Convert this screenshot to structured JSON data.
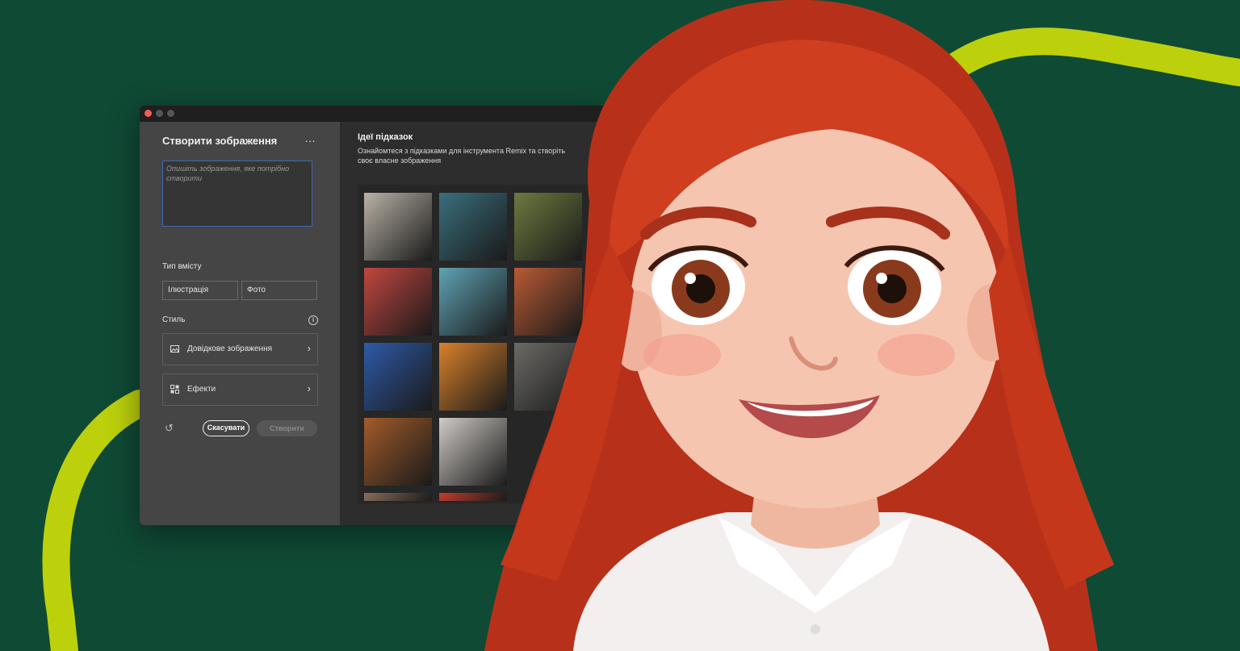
{
  "window": {
    "panel_title": "Створити зображення",
    "more_icon": "…",
    "prompt_placeholder": "Опишіть зображення, яке потрібно створити",
    "content_type_label": "Тип вмісту",
    "content_types": [
      "Ілюстрація",
      "Фото"
    ],
    "style_label": "Стиль",
    "info_icon": "i",
    "reference_image_label": "Довідкове зображення",
    "effects_label": "Ефекти",
    "chevron": "›",
    "undo_icon": "↺",
    "cancel_label": "Скасувати",
    "create_label": "Створити"
  },
  "ideas": {
    "title": "Ідеї підказок",
    "description": "Ознайомтеся з підказками для інструмента Remix та створіть своє власне зображення",
    "thumbnails": [
      {
        "name": "thumb-old-man-sketch",
        "color": "#b9b2a6"
      },
      {
        "name": "thumb-dinosaur",
        "color": "#3a6f7d"
      },
      {
        "name": "thumb-terrace",
        "color": "#6d7a3f"
      },
      {
        "name": "thumb-afro-woman",
        "color": "#c2463f"
      },
      {
        "name": "thumb-coffee-cup",
        "color": "#5fa3b4"
      },
      {
        "name": "thumb-soup",
        "color": "#b85a34"
      },
      {
        "name": "thumb-floating-island",
        "color": "#2e5aa8"
      },
      {
        "name": "thumb-colorful-house",
        "color": "#d9812b"
      },
      {
        "name": "thumb-interior",
        "color": "#6b6a66"
      },
      {
        "name": "thumb-koala",
        "color": "#a25b2a"
      },
      {
        "name": "thumb-woman-portrait",
        "color": "#cfcac5"
      },
      {
        "name": "thumb-partial-1",
        "color": "#8a6d5a"
      },
      {
        "name": "thumb-partial-2",
        "color": "#c23d2c"
      }
    ]
  },
  "colors": {
    "background": "#0f4a35",
    "accent_curve": "#bcd10c",
    "hair": "#c8391d"
  }
}
